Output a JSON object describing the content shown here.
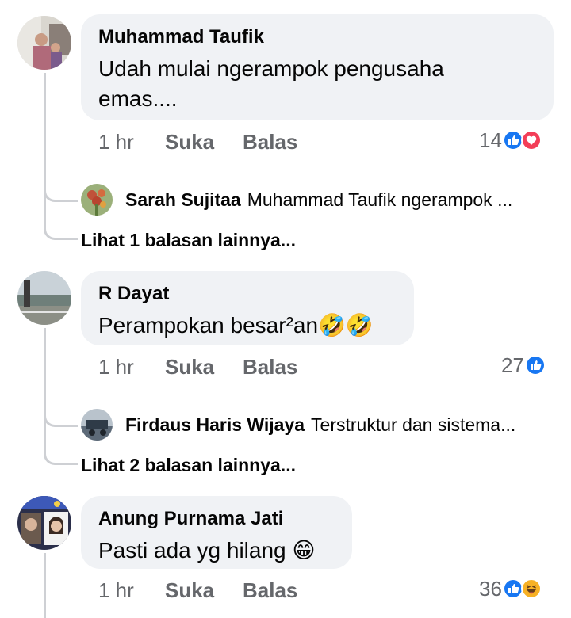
{
  "comments": [
    {
      "author": "Muhammad Taufik",
      "text_line1": "Udah mulai ngerampok pengusaha",
      "text_line2": "emas....",
      "time": "1 hr",
      "like_label": "Suka",
      "reply_label": "Balas",
      "reaction_count": "14",
      "reactions": [
        "like-icon",
        "love-icon"
      ],
      "reply_preview": {
        "author": "Sarah Sujitaa",
        "text": "Muhammad Taufik ngerampok ..."
      },
      "more_replies": "Lihat 1 balasan lainnya..."
    },
    {
      "author": "R Dayat",
      "text": "Perampokan besar²an🤣🤣",
      "time": "1 hr",
      "like_label": "Suka",
      "reply_label": "Balas",
      "reaction_count": "27",
      "reactions": [
        "like-icon"
      ],
      "reply_preview": {
        "author": "Firdaus Haris Wijaya",
        "text": "Terstruktur dan sistema..."
      },
      "more_replies": "Lihat 2 balasan lainnya..."
    },
    {
      "author": "Anung Purnama Jati",
      "text": "Pasti ada yg hilang 😁",
      "time": "1 hr",
      "like_label": "Suka",
      "reply_label": "Balas",
      "reaction_count": "36",
      "reactions": [
        "like-icon",
        "haha-icon"
      ]
    }
  ],
  "colors": {
    "bubble": "#f0f2f5",
    "meta_text": "#65676b",
    "thread_line": "#ced0d4",
    "like_blue": "#1877f2",
    "love_red": "#f33e58",
    "haha_yellow": "#f7b125"
  }
}
